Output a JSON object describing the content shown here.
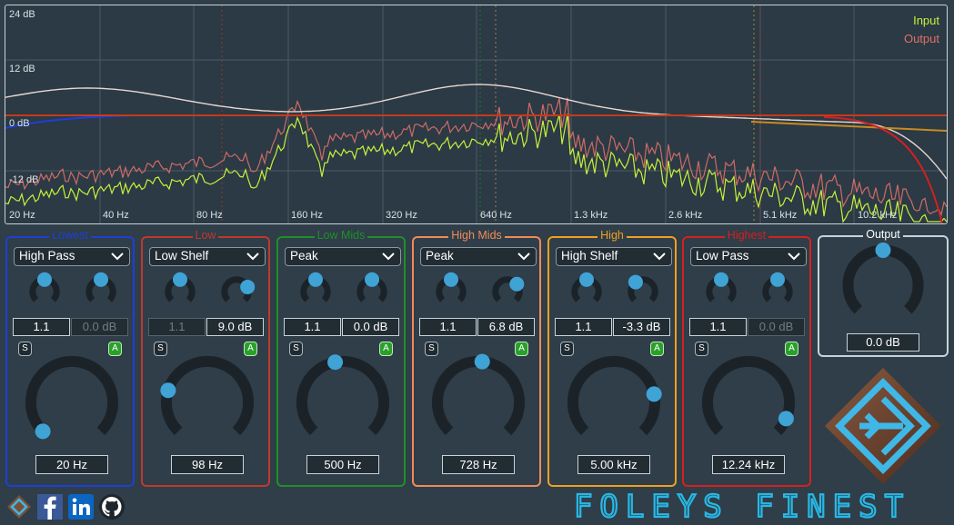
{
  "analyser": {
    "db_labels": [
      "24 dB",
      "12 dB",
      "0 dB",
      "-12 dB"
    ],
    "hz_labels": [
      "20 Hz",
      "40 Hz",
      "80 Hz",
      "160 Hz",
      "320 Hz",
      "640 Hz",
      "1.3 kHz",
      "2.6 kHz",
      "5.1 kHz",
      "10.2 kHz"
    ],
    "legend_input": "Input",
    "legend_output": "Output",
    "colors": {
      "input": "#c8f03c",
      "output": "#e0706a",
      "curve": "#e8d6d2",
      "grid": "#4b5a63"
    }
  },
  "bands": [
    {
      "title": "Lowest",
      "color": "#1e3fd8",
      "type": "High Pass",
      "q": "1.1",
      "gain": "0.0 dB",
      "q_dim": false,
      "gain_dim": true,
      "freq": "20 Hz",
      "solo": "S",
      "active": "A",
      "q_level": 0.5,
      "gain_level": 0.5,
      "freq_level": 0.0
    },
    {
      "title": "Low",
      "color": "#c0392b",
      "type": "Low Shelf",
      "q": "1.1",
      "gain": "9.0 dB",
      "q_dim": true,
      "gain_dim": false,
      "freq": "98 Hz",
      "solo": "S",
      "active": "A",
      "q_level": 0.5,
      "gain_level": 0.75,
      "freq_level": 0.23
    },
    {
      "title": "Low Mids",
      "color": "#1f8f2a",
      "type": "Peak",
      "q": "1.1",
      "gain": "0.0 dB",
      "q_dim": false,
      "gain_dim": false,
      "freq": "500 Hz",
      "solo": "S",
      "active": "A",
      "q_level": 0.5,
      "gain_level": 0.5,
      "freq_level": 0.46
    },
    {
      "title": "High Mids",
      "color": "#f08a5a",
      "type": "Peak",
      "q": "1.1",
      "gain": "6.8 dB",
      "q_dim": false,
      "gain_dim": false,
      "freq": "728 Hz",
      "solo": "S",
      "active": "A",
      "q_level": 0.5,
      "gain_level": 0.69,
      "freq_level": 0.52
    },
    {
      "title": "High",
      "color": "#f0a020",
      "type": "High Shelf",
      "q": "1.1",
      "gain": "-3.3 dB",
      "q_dim": false,
      "gain_dim": false,
      "freq": "5.00 kHz",
      "solo": "S",
      "active": "A",
      "q_level": 0.5,
      "gain_level": 0.36,
      "freq_level": 0.79
    },
    {
      "title": "Highest",
      "color": "#d42020",
      "type": "Low Pass",
      "q": "1.1",
      "gain": "0.0 dB",
      "q_dim": false,
      "gain_dim": true,
      "freq": "12.24 kHz",
      "solo": "S",
      "active": "A",
      "q_level": 0.5,
      "gain_level": 0.5,
      "freq_level": 0.92
    }
  ],
  "output": {
    "title": "Output",
    "value": "0.0 dB",
    "level": 0.5
  },
  "knob_color": "#3fa3d6",
  "brand": "FOLEYS FINEST",
  "social": [
    "foleys-icon",
    "facebook-icon",
    "linkedin-icon",
    "github-icon"
  ]
}
